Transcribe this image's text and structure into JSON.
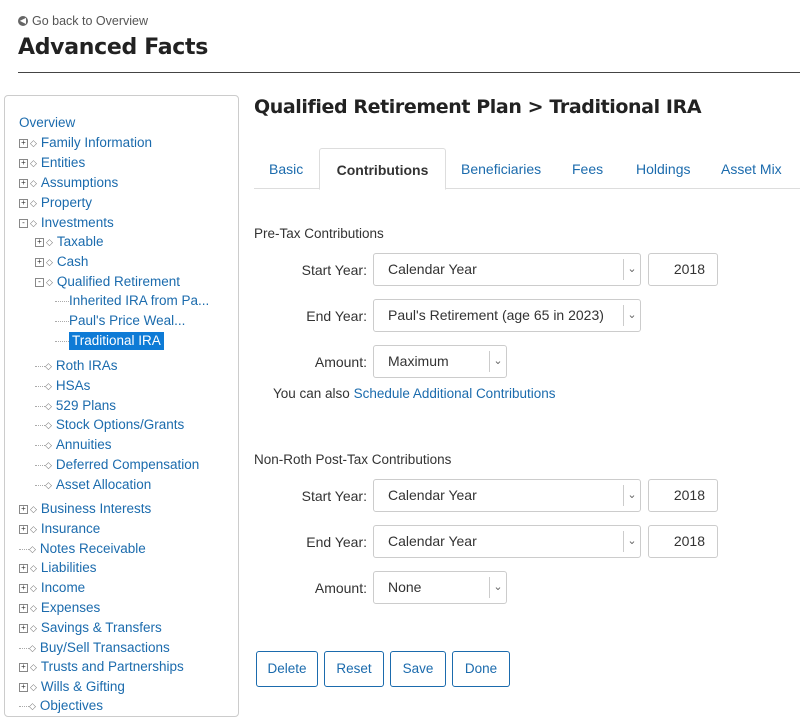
{
  "header": {
    "back_label": "Go back to Overview",
    "title": "Advanced Facts"
  },
  "tree": {
    "overview": "Overview",
    "items": [
      {
        "label": "Family Information"
      },
      {
        "label": "Entities"
      },
      {
        "label": "Assumptions"
      },
      {
        "label": "Property"
      },
      {
        "label": "Investments"
      },
      {
        "label": "Taxable"
      },
      {
        "label": "Cash"
      },
      {
        "label": "Qualified Retirement"
      },
      {
        "label": "Inherited IRA from Pa..."
      },
      {
        "label": "Paul's Price Weal..."
      },
      {
        "label": "Traditional IRA"
      },
      {
        "label": "Roth IRAs"
      },
      {
        "label": "HSAs"
      },
      {
        "label": "529 Plans"
      },
      {
        "label": "Stock Options/Grants"
      },
      {
        "label": "Annuities"
      },
      {
        "label": "Deferred Compensation"
      },
      {
        "label": "Asset Allocation"
      },
      {
        "label": "Business Interests"
      },
      {
        "label": "Insurance"
      },
      {
        "label": "Notes Receivable"
      },
      {
        "label": "Liabilities"
      },
      {
        "label": "Income"
      },
      {
        "label": "Expenses"
      },
      {
        "label": "Savings & Transfers"
      },
      {
        "label": "Buy/Sell Transactions"
      },
      {
        "label": "Trusts and Partnerships"
      },
      {
        "label": "Wills & Gifting"
      },
      {
        "label": "Objectives"
      }
    ]
  },
  "main": {
    "section_title": "Qualified Retirement Plan > Traditional IRA",
    "tabs": [
      {
        "label": "Basic"
      },
      {
        "label": "Contributions"
      },
      {
        "label": "Beneficiaries"
      },
      {
        "label": "Fees"
      },
      {
        "label": "Holdings"
      },
      {
        "label": "Asset Mix"
      }
    ],
    "pretax": {
      "heading": "Pre-Tax Contributions",
      "start_label": "Start Year:",
      "start_value": "Calendar Year",
      "start_year": "2018",
      "end_label": "End Year:",
      "end_value": "Paul's Retirement (age 65 in 2023)",
      "amount_label": "Amount:",
      "amount_value": "Maximum",
      "hint_prefix": "You can also",
      "hint_link": "Schedule Additional Contributions"
    },
    "posttax": {
      "heading": "Non-Roth Post-Tax Contributions",
      "start_label": "Start Year:",
      "start_value": "Calendar Year",
      "start_year": "2018",
      "end_label": "End Year:",
      "end_value": "Calendar Year",
      "end_year": "2018",
      "amount_label": "Amount:",
      "amount_value": "None"
    },
    "buttons": {
      "delete": "Delete",
      "reset": "Reset",
      "save": "Save",
      "done": "Done"
    }
  }
}
